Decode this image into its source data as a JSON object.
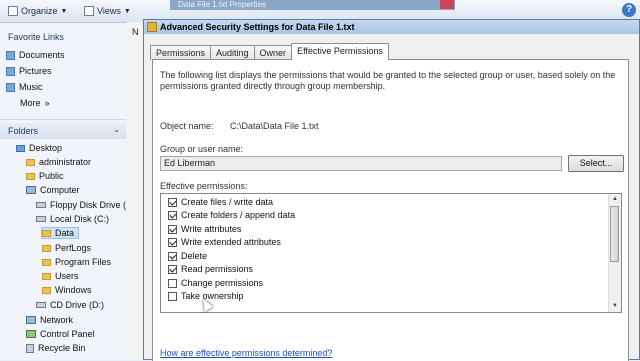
{
  "toolbar": {
    "organize_label": "Organize",
    "views_label": "Views",
    "background_title": "Data File 1.txt Properties"
  },
  "nav": {
    "favorites_heading": "Favorite Links",
    "favorites": [
      "Documents",
      "Pictures",
      "Music",
      "More"
    ],
    "folders_heading": "Folders",
    "tree": [
      "Desktop",
      "administrator",
      "Public",
      "Computer",
      "Floppy Disk Drive (A",
      "Local Disk (C:)",
      "Data",
      "PerfLogs",
      "Program Files",
      "Users",
      "Windows",
      "CD Drive (D:)",
      "Network",
      "Control Panel",
      "Recycle Bin"
    ],
    "behind_letter": "N"
  },
  "dialog": {
    "title": "Advanced Security Settings for Data File 1.txt",
    "tabs": [
      "Permissions",
      "Auditing",
      "Owner",
      "Effective Permissions"
    ],
    "intro": "The following list displays the permissions that would be granted to the selected group or user, based solely on the permissions granted directly through group membership.",
    "object_name_label": "Object name:",
    "object_name_value": "C:\\Data\\Data File 1.txt",
    "group_label": "Group or user name:",
    "group_value": "Ed Liberman",
    "select_button": "Select...",
    "effective_label": "Effective permissions:",
    "permissions": [
      {
        "label": "Create files / write data",
        "checked": true
      },
      {
        "label": "Create folders / append data",
        "checked": true
      },
      {
        "label": "Write attributes",
        "checked": true
      },
      {
        "label": "Write extended attributes",
        "checked": true
      },
      {
        "label": "Delete",
        "checked": true
      },
      {
        "label": "Read permissions",
        "checked": true
      },
      {
        "label": "Change permissions",
        "checked": false
      },
      {
        "label": "Take ownership",
        "checked": false
      }
    ],
    "help_link": "How are effective permissions determined?"
  }
}
